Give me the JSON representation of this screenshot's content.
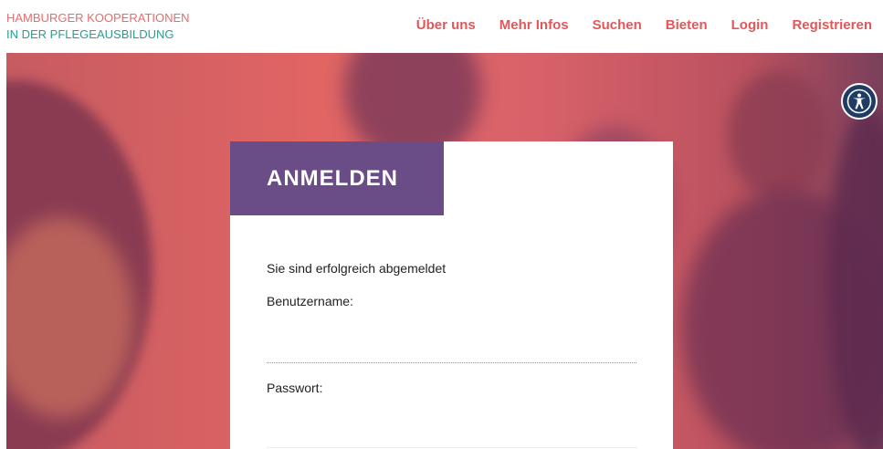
{
  "header": {
    "logo_line1": "HAMBURGER KOOPERATIONEN",
    "logo_line2": "IN DER PFLEGEAUSBILDUNG",
    "nav": [
      {
        "label": "Über uns"
      },
      {
        "label": "Mehr Infos"
      },
      {
        "label": "Suchen"
      },
      {
        "label": "Bieten"
      },
      {
        "label": "Login"
      },
      {
        "label": "Registrieren"
      }
    ]
  },
  "accessibility": {
    "icon": "accessibility-icon"
  },
  "login": {
    "title": "ANMELDEN",
    "message": "Sie sind erfolgreich abgemeldet",
    "username_label": "Benutzername:",
    "username_value": "",
    "password_label": "Passwort:",
    "password_value": ""
  },
  "colors": {
    "brand_red": "#e2575a",
    "brand_teal": "#2a9d8f",
    "card_title_bg": "#6a4c87",
    "accessibility_bg": "#1e3c64"
  }
}
